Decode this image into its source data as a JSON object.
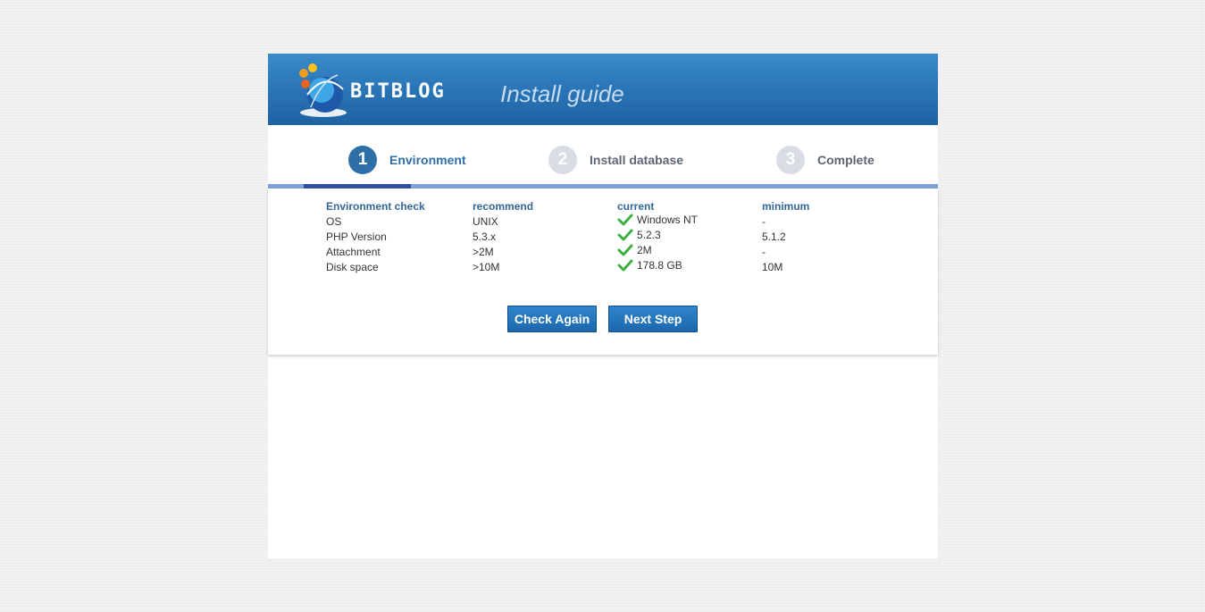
{
  "header": {
    "logo_text": "BITBLOG",
    "title": "Install guide"
  },
  "steps": [
    {
      "number": "1",
      "label": "Environment",
      "active": true
    },
    {
      "number": "2",
      "label": "Install database",
      "active": false
    },
    {
      "number": "3",
      "label": "Complete",
      "active": false
    }
  ],
  "env_table": {
    "headers": [
      "Environment check",
      "recommend",
      "current",
      "minimum"
    ],
    "rows": [
      {
        "check": "OS",
        "recommend": "UNIX",
        "current": "Windows NT",
        "minimum": "-"
      },
      {
        "check": "PHP Version",
        "recommend": "5.3.x",
        "current": "5.2.3",
        "minimum": "5.1.2"
      },
      {
        "check": "Attachment",
        "recommend": ">2M",
        "current": "2M",
        "minimum": "-"
      },
      {
        "check": "Disk space",
        "recommend": ">10M",
        "current": "178.8 GB",
        "minimum": "10M"
      }
    ]
  },
  "buttons": {
    "check_again": "Check Again",
    "next_step": "Next Step"
  },
  "colors": {
    "header_blue": "#2c79bb",
    "active_step": "#2f6fa8",
    "check_green": "#3cb043"
  }
}
